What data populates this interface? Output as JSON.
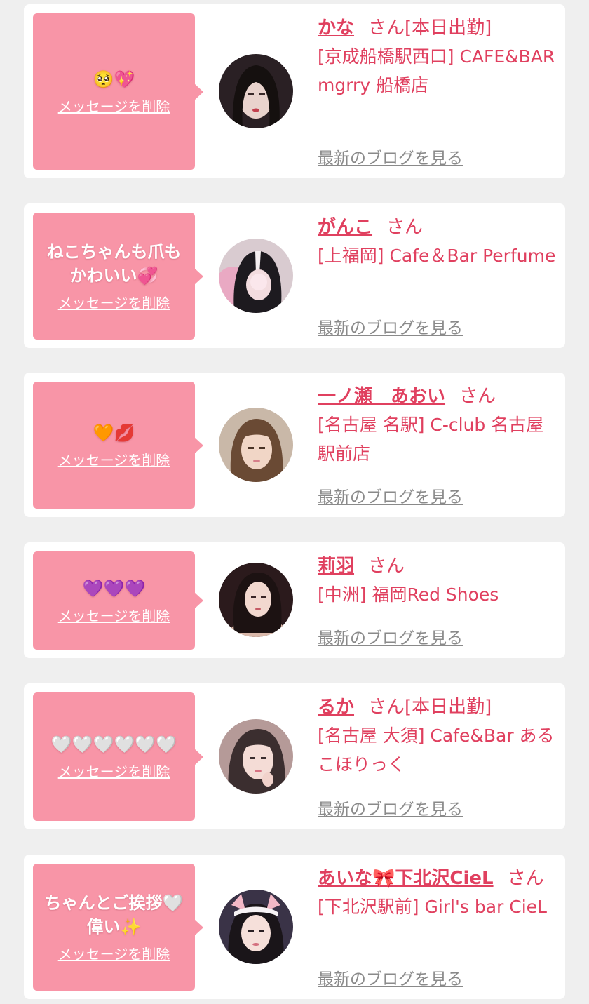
{
  "delete_label": "メッセージを削除",
  "blog_label": "最新のブログを見る",
  "san_label": "さん",
  "cards": [
    {
      "message": "🥺💖",
      "name": "かな",
      "status": "[本日出勤]",
      "shop": "[京成船橋駅西口] CAFE&BAR mgrry 船橋店"
    },
    {
      "message": "ねこちゃんも爪もかわいい💞",
      "name": "がんこ",
      "status": "",
      "shop": "[上福岡] Cafe＆Bar Perfume"
    },
    {
      "message": "🧡💋",
      "name": "一ノ瀬　あおい",
      "status": "",
      "shop": "[名古屋 名駅] C-club 名古屋駅前店"
    },
    {
      "message": "💜💜💜",
      "name": "莉羽",
      "status": "",
      "shop": "[中洲] 福岡Red Shoes"
    },
    {
      "message": "🤍🤍🤍🤍🤍🤍",
      "name": "るか",
      "status": "[本日出勤]",
      "shop": "[名古屋 大須] Cafe&Bar あるこほりっく"
    },
    {
      "message": "ちゃんとご挨拶🤍偉い✨",
      "name": "あいな🎀下北沢CieL",
      "status": "",
      "shop": "[下北沢駅前] Girl's bar CieL"
    }
  ]
}
